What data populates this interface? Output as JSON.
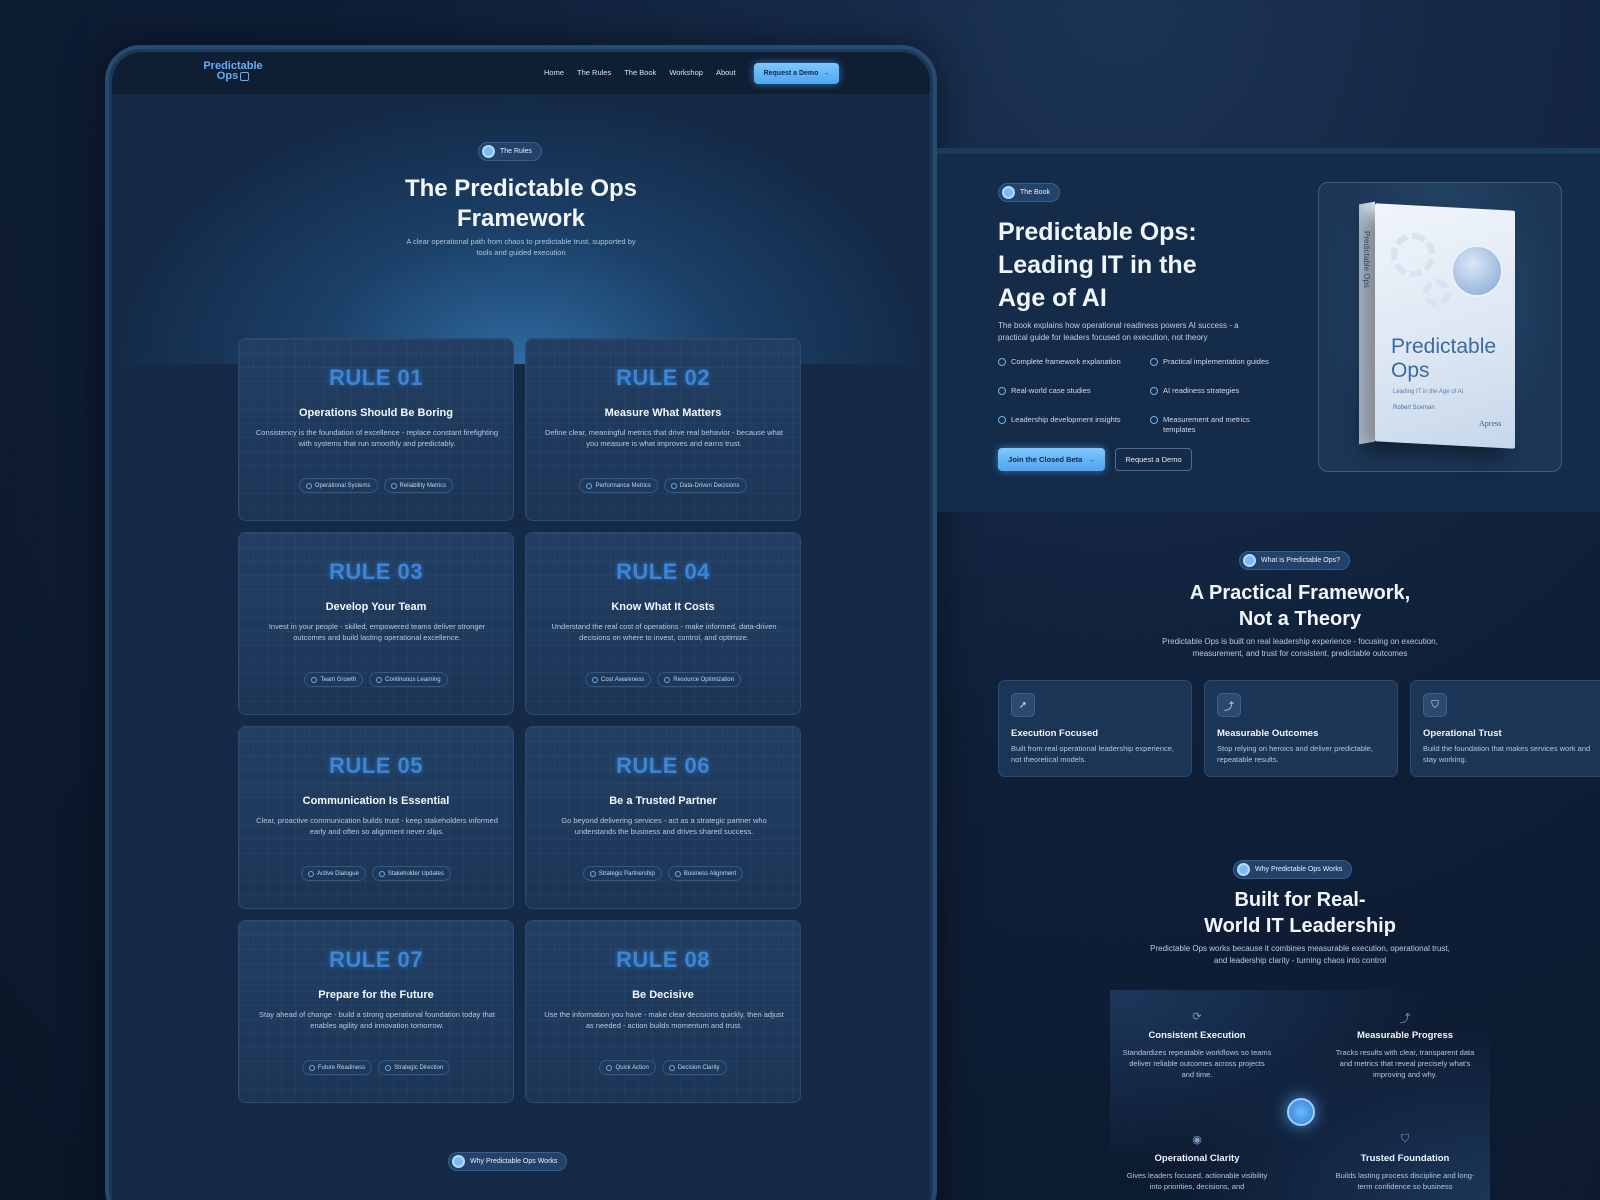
{
  "nav": {
    "logo_line1": "Predictable",
    "logo_line2": "Ops",
    "links": [
      "Home",
      "The Rules",
      "The Book",
      "Workshop",
      "About"
    ],
    "cta": "Request a Demo"
  },
  "hero": {
    "pill": "The Rules",
    "title_line1": "The Predictable Ops",
    "title_line2": "Framework",
    "subtitle": "A clear operational path from chaos to predictable trust, supported by tools and guided execution"
  },
  "rules": [
    {
      "num": "RULE 01",
      "title": "Operations Should Be Boring",
      "desc": "Consistency is the foundation of excellence - replace constant firefighting with systems that run smoothly and predictably.",
      "tags": [
        "Operational Systems",
        "Reliability Metrics"
      ]
    },
    {
      "num": "RULE 02",
      "title": "Measure What Matters",
      "desc": "Define clear, meaningful metrics that drive real behavior - because what you measure is what improves and earns trust.",
      "tags": [
        "Performance Metrics",
        "Data-Driven Decisions"
      ]
    },
    {
      "num": "RULE 03",
      "title": "Develop Your Team",
      "desc": "Invest in your people - skilled, empowered teams deliver stronger outcomes and build lasting operational excellence.",
      "tags": [
        "Team Growth",
        "Continuous Learning"
      ]
    },
    {
      "num": "RULE 04",
      "title": "Know What It Costs",
      "desc": "Understand the real cost of operations - make informed, data-driven decisions on where to invest, control, and optimize.",
      "tags": [
        "Cost Awareness",
        "Resource Optimization"
      ]
    },
    {
      "num": "RULE 05",
      "title": "Communication Is Essential",
      "desc": "Clear, proactive communication builds trust - keep stakeholders informed early and often so alignment never slips.",
      "tags": [
        "Active Dialogue",
        "Stakeholder Updates"
      ]
    },
    {
      "num": "RULE 06",
      "title": "Be a Trusted Partner",
      "desc": "Go beyond delivering services - act as a strategic partner who understands the business and drives shared success.",
      "tags": [
        "Strategic Partnership",
        "Business Alignment"
      ]
    },
    {
      "num": "RULE 07",
      "title": "Prepare for the Future",
      "desc": "Stay ahead of change - build a strong operational foundation today that enables agility and innovation tomorrow.",
      "tags": [
        "Future Readiness",
        "Strategic Direction"
      ]
    },
    {
      "num": "RULE 08",
      "title": "Be Decisive",
      "desc": "Use the information you have - make clear decisions quickly, then adjust as needed - action builds momentum and trust.",
      "tags": [
        "Quick Action",
        "Decision Clarity"
      ]
    }
  ],
  "bottom_pill": "Why Predictable Ops Works",
  "book": {
    "pill": "The Book",
    "title": "Predictable Ops: Leading IT in the Age of AI",
    "desc": "The book explains how operational readiness powers AI success - a practical guide for leaders focused on execution, not theory",
    "features": [
      "Complete framework explanation",
      "Practical implementation guides",
      "Real-world case studies",
      "AI readiness strategies",
      "Leadership development insights",
      "Measurement and metrics templates"
    ],
    "primary_btn": "Join the Closed Beta",
    "secondary_btn": "Request a Demo",
    "cover": {
      "spine": "Predictable Ops",
      "title_line1": "Predictable",
      "title_line2": "Ops",
      "subtitle": "Leading IT in the Age of AI",
      "author": "Robert Sceman",
      "publisher": "Apress"
    }
  },
  "what": {
    "pill": "What is Predictable Ops?",
    "title_line1": "A Practical Framework,",
    "title_line2": "Not a Theory",
    "subtitle": "Predictable Ops is built on real leadership experience - focusing on execution, measurement, and trust for consistent, predictable outcomes",
    "cards": [
      {
        "icon": "rocket-icon",
        "title": "Execution Focused",
        "desc": "Built from real operational leadership experience, not theoretical models."
      },
      {
        "icon": "chart-icon",
        "title": "Measurable Outcomes",
        "desc": "Stop relying on heroics and deliver predictable, repeatable results."
      },
      {
        "icon": "shield-icon",
        "title": "Operational Trust",
        "desc": "Build the foundation that makes services work and stay working."
      }
    ]
  },
  "why": {
    "pill": "Why Predictable Ops Works",
    "title_line1": "Built for Real-",
    "title_line2": "World IT Leadership",
    "subtitle": "Predictable Ops works because it combines measurable execution, operational trust, and leadership clarity - turning chaos into control",
    "items": [
      {
        "icon": "refresh-icon",
        "title": "Consistent Execution",
        "desc": "Standardizes repeatable workflows so teams deliver reliable outcomes across projects and time."
      },
      {
        "icon": "trend-icon",
        "title": "Measurable Progress",
        "desc": "Tracks results with clear, transparent data and metrics that reveal precisely what's improving and why."
      },
      {
        "icon": "eye-icon",
        "title": "Operational Clarity",
        "desc": "Gives leaders focused, actionable visibility into priorities, decisions, and"
      },
      {
        "icon": "shield-icon",
        "title": "Trusted Foundation",
        "desc": "Builds lasting process discipline and long-term confidence so business"
      }
    ]
  }
}
